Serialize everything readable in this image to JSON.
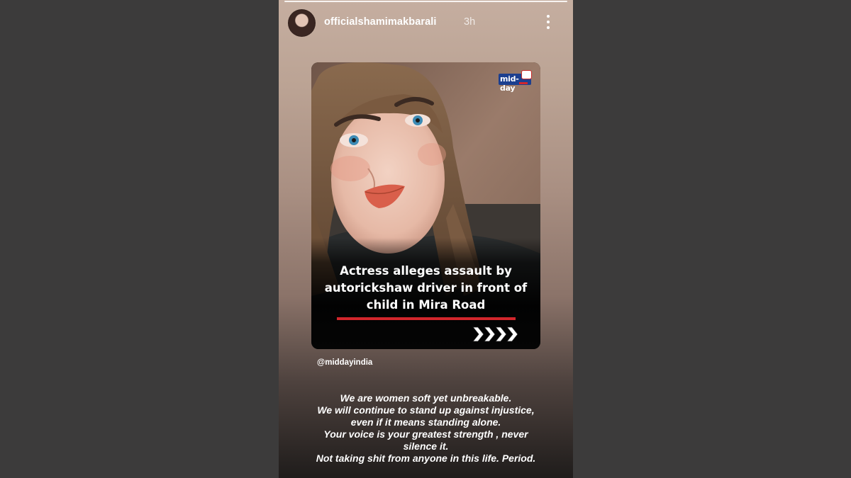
{
  "story": {
    "username": "officialshamimakbarali",
    "time": "3h",
    "menu_icon": "more-vertical-icon"
  },
  "card": {
    "logo_text": "mid-day",
    "headline": "Actress alleges assault by autorickshaw driver in front of child in Mira Road",
    "headline_lines": [
      "Actress alleges assault by",
      "autorickshaw driver in front of",
      "child in Mira Road"
    ],
    "arrow_icon": "chevrons-right-icon",
    "accent_color": "#d3262c"
  },
  "mention": "@middayindia",
  "message_lines": [
    "We are women soft yet unbreakable.",
    "We will continue to stand up against injustice,",
    "even if it means standing alone.",
    "Your voice is your greatest strength , never",
    "silence it.",
    "Not taking shit from anyone in this life. Period."
  ]
}
